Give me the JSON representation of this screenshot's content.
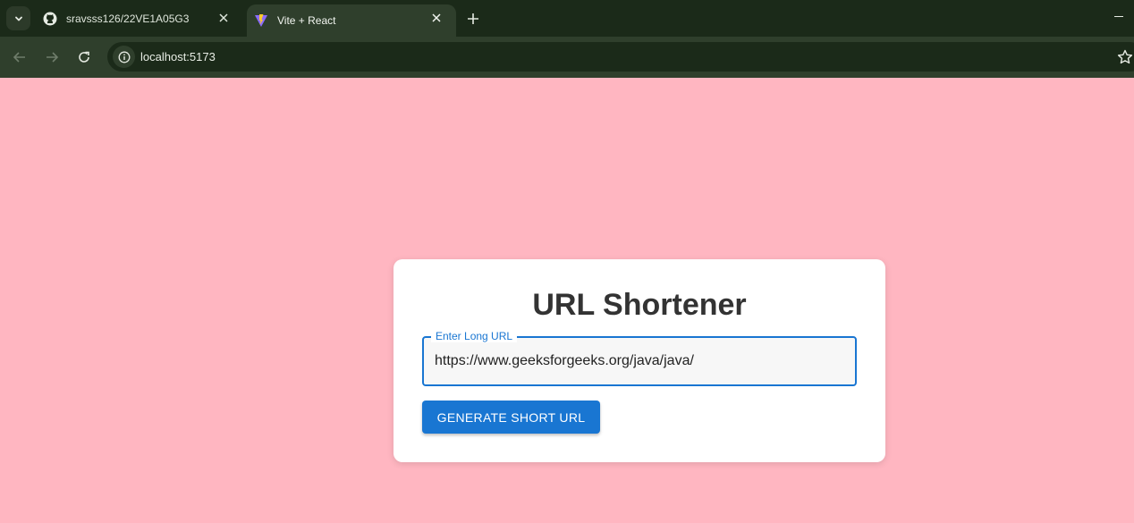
{
  "browser": {
    "tabs": [
      {
        "title": "sravsss126/22VE1A05G3",
        "icon": "github-icon",
        "active": false
      },
      {
        "title": "Vite + React",
        "icon": "vite-icon",
        "active": true
      }
    ],
    "address": "localhost:5173"
  },
  "app": {
    "title": "URL Shortener",
    "input_label": "Enter Long URL",
    "input_value": "https://www.geeksforgeeks.org/java/java/",
    "button_label": "GENERATE SHORT URL"
  },
  "colors": {
    "page_background": "#ffb6c1",
    "accent": "#1976d2",
    "chrome_dark": "#1b2a19",
    "chrome_toolbar": "#2f3f2c"
  }
}
